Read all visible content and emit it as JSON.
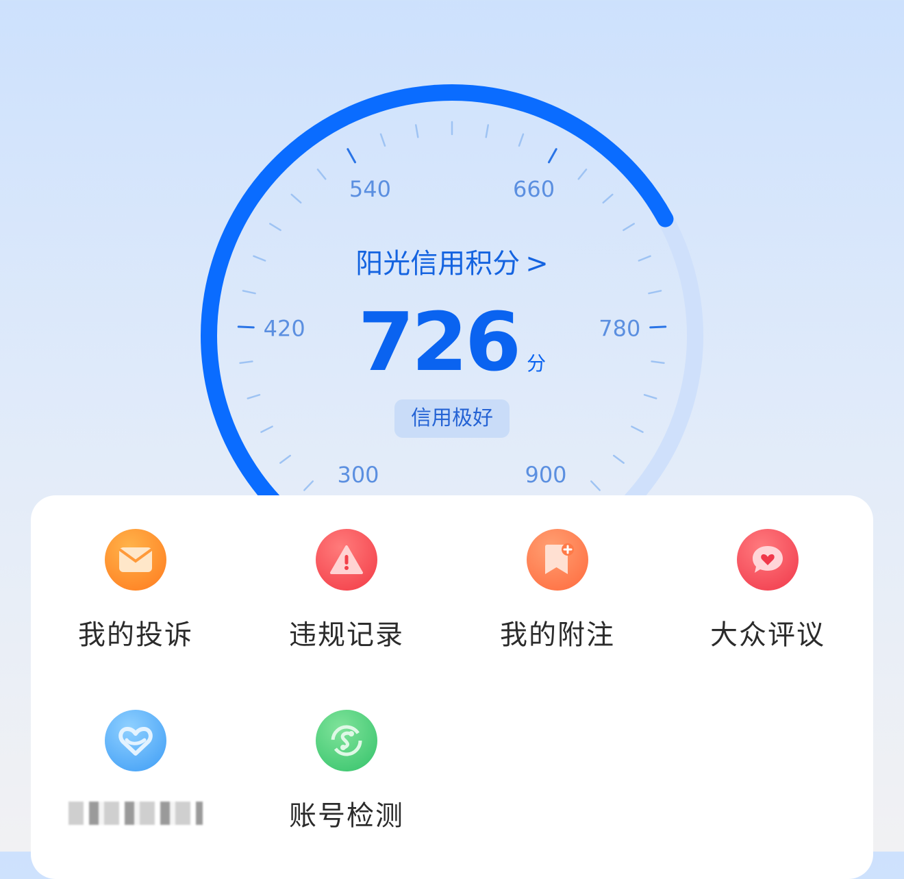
{
  "gauge": {
    "min": 300,
    "max": 900,
    "value": 726,
    "major_ticks": [
      "300",
      "420",
      "540",
      "660",
      "780",
      "900"
    ],
    "active_color": "#0a6cff",
    "track_color": "#cfe0fb"
  },
  "score": {
    "title": "阳光信用积分",
    "chevron": ">",
    "value": "726",
    "unit": "分",
    "rating": "信用极好"
  },
  "menu": {
    "items": [
      {
        "label": "我的投诉",
        "icon": "mail-icon"
      },
      {
        "label": "违规记录",
        "icon": "warning-icon"
      },
      {
        "label": "我的附注",
        "icon": "bookmark-plus-icon"
      },
      {
        "label": "大众评议",
        "icon": "heart-chat-icon"
      },
      {
        "label": "",
        "icon": "heart-icon"
      },
      {
        "label": "账号检测",
        "icon": "scan-icon"
      }
    ]
  }
}
